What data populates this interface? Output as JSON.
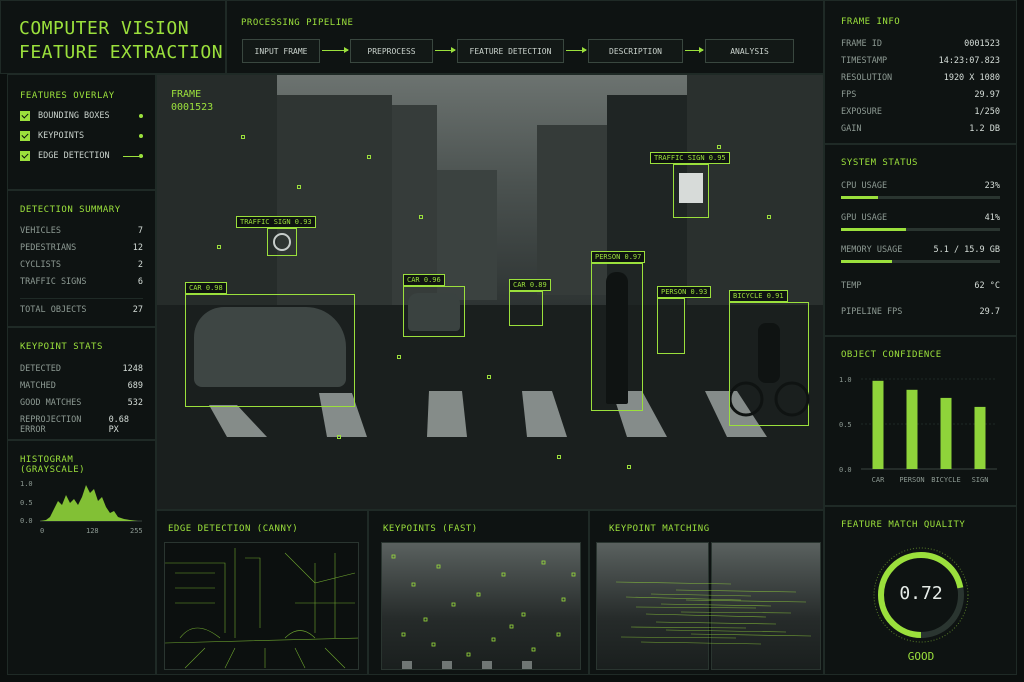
{
  "header": {
    "title_line1": "COMPUTER VISION",
    "title_line2": "FEATURE EXTRACTION",
    "pipeline_title": "PROCESSING PIPELINE",
    "pipeline_steps": [
      "INPUT FRAME",
      "PREPROCESS",
      "FEATURE DETECTION",
      "DESCRIPTION",
      "ANALYSIS"
    ]
  },
  "features_overlay": {
    "title": "FEATURES OVERLAY",
    "items": [
      {
        "label": "BOUNDING BOXES",
        "checked": true
      },
      {
        "label": "KEYPOINTS",
        "checked": true
      },
      {
        "label": "EDGE DETECTION",
        "checked": true
      }
    ]
  },
  "detection_summary": {
    "title": "DETECTION SUMMARY",
    "rows": [
      {
        "label": "VEHICLES",
        "value": "7"
      },
      {
        "label": "PEDESTRIANS",
        "value": "12"
      },
      {
        "label": "CYCLISTS",
        "value": "2"
      },
      {
        "label": "TRAFFIC SIGNS",
        "value": "6"
      }
    ],
    "total_label": "TOTAL OBJECTS",
    "total_value": "27"
  },
  "keypoint_stats": {
    "title": "KEYPOINT STATS",
    "rows": [
      {
        "label": "DETECTED",
        "value": "1248"
      },
      {
        "label": "MATCHED",
        "value": "689"
      },
      {
        "label": "GOOD MATCHES",
        "value": "532"
      },
      {
        "label": "REPROJECTION ERROR",
        "value": "0.68 px"
      }
    ]
  },
  "histogram": {
    "title": "HISTOGRAM (GRAYSCALE)",
    "y_ticks": [
      "1.0",
      "0.5",
      "0.0"
    ],
    "x_ticks": [
      "0",
      "128",
      "255"
    ]
  },
  "frame": {
    "label": "FRAME",
    "number": "0001523",
    "detections": [
      {
        "label": "TRAFFIC SIGN 0.93"
      },
      {
        "label": "TRAFFIC SIGN 0.95"
      },
      {
        "label": "CAR 0.98"
      },
      {
        "label": "CAR 0.96"
      },
      {
        "label": "CAR 0.89"
      },
      {
        "label": "PERSON 0.97"
      },
      {
        "label": "PERSON 0.93"
      },
      {
        "label": "BICYCLE 0.91"
      }
    ]
  },
  "bottom_views": {
    "edge_title": "EDGE DETECTION (CANNY)",
    "keypoints_title": "KEYPOINTS (FAST)",
    "matching_title": "KEYPOINT MATCHING"
  },
  "frame_info": {
    "title": "FRAME INFO",
    "rows": [
      {
        "label": "FRAME ID",
        "value": "0001523"
      },
      {
        "label": "TIMESTAMP",
        "value": "14:23:07.823"
      },
      {
        "label": "RESOLUTION",
        "value": "1920 x 1080"
      },
      {
        "label": "FPS",
        "value": "29.97"
      },
      {
        "label": "EXPOSURE",
        "value": "1/250"
      },
      {
        "label": "GAIN",
        "value": "1.2 dB"
      }
    ]
  },
  "system_status": {
    "title": "SYSTEM STATUS",
    "cpu_label": "CPU USAGE",
    "cpu_value": "23%",
    "cpu_fraction": 0.23,
    "gpu_label": "GPU USAGE",
    "gpu_value": "41%",
    "gpu_fraction": 0.41,
    "mem_label": "MEMORY USAGE",
    "mem_value": "5.1 / 15.9 GB",
    "mem_fraction": 0.32,
    "temp_label": "TEMP",
    "temp_value": "62 °C",
    "fps_label": "PIPELINE FPS",
    "fps_value": "29.7"
  },
  "chart_data": {
    "type": "bar",
    "title": "OBJECT CONFIDENCE",
    "categories": [
      "CAR",
      "PERSON",
      "BICYCLE",
      "SIGN"
    ],
    "values": [
      0.98,
      0.88,
      0.79,
      0.69
    ],
    "y_ticks": [
      "1.0",
      "0.5",
      "0.0"
    ],
    "ylim": [
      0,
      1
    ],
    "bar_color": "#8fd43a"
  },
  "match_quality": {
    "title": "FEATURE MATCH QUALITY",
    "value": "0.72",
    "fraction": 0.72,
    "status": "GOOD"
  },
  "accent_color": "#9be03c"
}
